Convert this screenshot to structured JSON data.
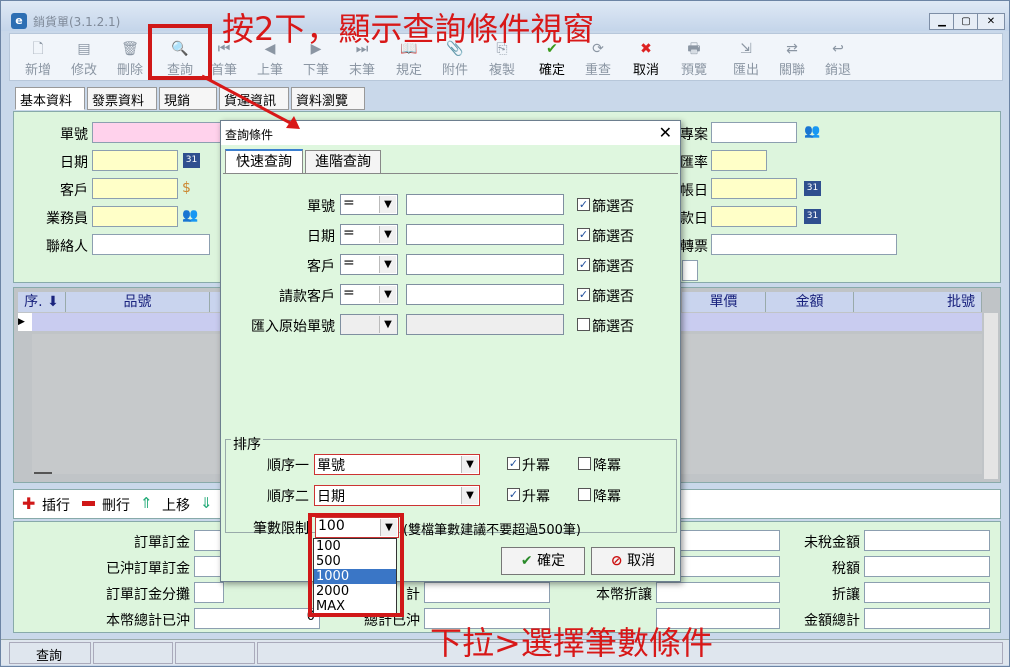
{
  "window": {
    "title": "銷貨單(3.1.2.1)",
    "app_icon": "e"
  },
  "toolbar": [
    {
      "label": "新增",
      "icon": "new-icon",
      "glyph": "🗋",
      "enabled": false
    },
    {
      "label": "修改",
      "icon": "edit-icon",
      "glyph": "▤",
      "enabled": false
    },
    {
      "label": "刪除",
      "icon": "delete-icon",
      "glyph": "🗑",
      "enabled": false
    },
    {
      "label": "查詢",
      "icon": "search-icon",
      "glyph": "🔍",
      "enabled": false
    },
    {
      "label": "首筆",
      "icon": "first-icon",
      "glyph": "⏮",
      "enabled": false
    },
    {
      "label": "上筆",
      "icon": "prev-icon",
      "glyph": "◀",
      "enabled": false
    },
    {
      "label": "下筆",
      "icon": "next-icon",
      "glyph": "▶",
      "enabled": false
    },
    {
      "label": "末筆",
      "icon": "last-icon",
      "glyph": "⏭",
      "enabled": false
    },
    {
      "label": "規定",
      "icon": "book-icon",
      "glyph": "📖",
      "enabled": false
    },
    {
      "label": "附件",
      "icon": "attach-icon",
      "glyph": "📎",
      "enabled": false
    },
    {
      "label": "複製",
      "icon": "copy-icon",
      "glyph": "⎘",
      "enabled": false
    },
    {
      "label": "確定",
      "icon": "check-icon",
      "glyph": "✔",
      "enabled": true
    },
    {
      "label": "重查",
      "icon": "refresh-icon",
      "glyph": "⟳",
      "enabled": false
    },
    {
      "label": "取消",
      "icon": "cancel-icon",
      "glyph": "✖",
      "enabled": true
    },
    {
      "label": "預覽",
      "icon": "print-icon",
      "glyph": "🖶",
      "enabled": false
    },
    {
      "label": "匯出",
      "icon": "export-icon",
      "glyph": "⇲",
      "enabled": false
    },
    {
      "label": "關聯",
      "icon": "link-icon",
      "glyph": "⇄",
      "enabled": false
    },
    {
      "label": "銷退",
      "icon": "return-icon",
      "glyph": "↩",
      "enabled": false
    }
  ],
  "tabs": [
    "基本資料",
    "發票資料",
    "現銷",
    "貨運資訊",
    "資料瀏覽"
  ],
  "form": {
    "left_labels": [
      "單號",
      "日期",
      "客戶",
      "業務員",
      "聯絡人"
    ],
    "right_labels": [
      "專案",
      "匯率",
      "帳日",
      "款日",
      "轉票"
    ]
  },
  "grid": {
    "headers": [
      "序.",
      "品號",
      "單價",
      "金額",
      "批號"
    ]
  },
  "rowbar": {
    "insert": "插行",
    "delete": "刪行",
    "up": "上移",
    "down": "下移"
  },
  "bottom": {
    "left_labels": [
      "訂單訂金",
      "已沖訂單訂金",
      "訂單訂金分攤",
      "本幣總計已沖"
    ],
    "left_value4": "0",
    "mid_labels": [
      "計",
      "總計已沖"
    ],
    "right_mid_labels": [
      "本幣折讓"
    ],
    "right_labels": [
      "未稅金額",
      "稅額",
      "折讓",
      "金額總計"
    ]
  },
  "status": {
    "text": "查詢"
  },
  "dialog": {
    "title": "查詢條件",
    "tabs": [
      "快速查詢",
      "進階查詢"
    ],
    "rows": [
      {
        "label": "單號",
        "op": "=",
        "filter": "篩選否",
        "checked": true,
        "enabled": true
      },
      {
        "label": "日期",
        "op": "=",
        "filter": "篩選否",
        "checked": true,
        "enabled": true
      },
      {
        "label": "客戶",
        "op": "=",
        "filter": "篩選否",
        "checked": true,
        "enabled": true
      },
      {
        "label": "請款客戶",
        "op": "=",
        "filter": "篩選否",
        "checked": true,
        "enabled": true
      },
      {
        "label": "匯入原始單號",
        "op": "",
        "filter": "篩選否",
        "checked": false,
        "enabled": false
      }
    ],
    "sort": {
      "group_label": "排序",
      "rows": [
        {
          "label": "順序一",
          "value": "單號",
          "asc": "升冪",
          "asc_checked": true,
          "desc": "降冪",
          "desc_checked": false
        },
        {
          "label": "順序二",
          "value": "日期",
          "asc": "升冪",
          "asc_checked": true,
          "desc": "降冪",
          "desc_checked": false
        }
      ],
      "limit_label": "筆數限制",
      "limit_value": "100",
      "limit_note": "(雙檔筆數建議不要超過500筆)",
      "options": [
        "100",
        "500",
        "1000",
        "2000",
        "MAX"
      ],
      "highlight_option": "1000"
    },
    "ok": "確定",
    "cancel": "取消"
  },
  "annotations": {
    "top": "按2下，顯示查詢條件視窗",
    "bottom": "下拉>選擇筆數條件",
    "color": "#d81818"
  }
}
